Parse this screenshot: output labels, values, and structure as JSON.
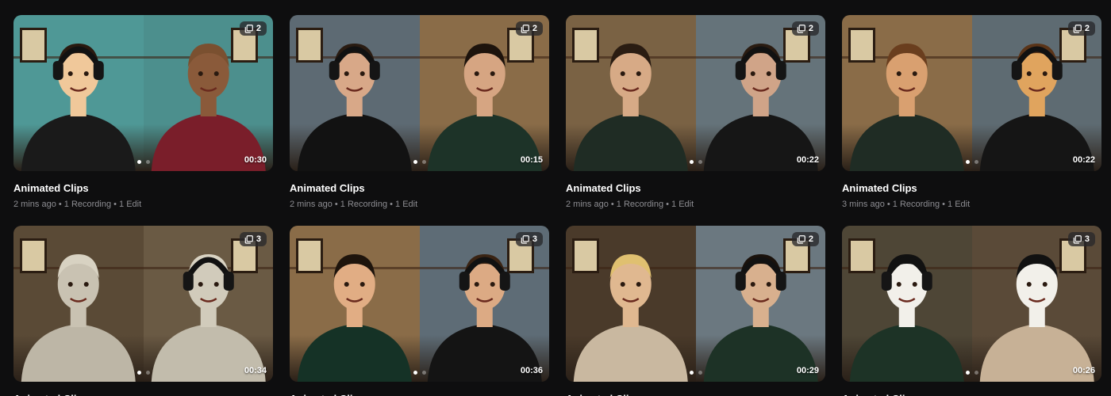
{
  "cards": [
    {
      "title": "Animated Clips",
      "meta": "2 mins ago • 1 Recording • 1 Edit",
      "count": "2",
      "duration": "00:30",
      "left": {
        "bg": "#4f9896",
        "skin": "#f0c89a",
        "shirt": "#1a1a1a",
        "hair": "#2a1a10",
        "headphones": true
      },
      "right": {
        "bg": "#4c8f8d",
        "skin": "#8a5a3a",
        "shirt": "#7a1e2a",
        "hair": "#7a5030",
        "headphones": false
      }
    },
    {
      "title": "Animated Clips",
      "meta": "2 mins ago • 1 Recording • 1 Edit",
      "count": "2",
      "duration": "00:15",
      "left": {
        "bg": "#5d6a73",
        "skin": "#d8a888",
        "shirt": "#121212",
        "hair": "#2a1c12",
        "headphones": true
      },
      "right": {
        "bg": "#8a6c48",
        "skin": "#d6a582",
        "shirt": "#1d3328",
        "hair": "#1d130c",
        "headphones": false
      }
    },
    {
      "title": "Animated Clips",
      "meta": "2 mins ago • 1 Recording • 1 Edit",
      "count": "2",
      "duration": "00:22",
      "left": {
        "bg": "#7a6244",
        "skin": "#d7aa86",
        "shirt": "#1f2c24",
        "hair": "#2a1c12",
        "headphones": false
      },
      "right": {
        "bg": "#65737a",
        "skin": "#d0a488",
        "shirt": "#161616",
        "hair": "#2a1c12",
        "headphones": true
      }
    },
    {
      "title": "Animated Clips",
      "meta": "3 mins ago • 1 Recording • 1 Edit",
      "count": "2",
      "duration": "00:22",
      "left": {
        "bg": "#8a6c48",
        "skin": "#d9a070",
        "shirt": "#1f2c24",
        "hair": "#6a3e1e",
        "headphones": false
      },
      "right": {
        "bg": "#5e6b72",
        "skin": "#e0a45e",
        "shirt": "#151515",
        "hair": "#5a3418",
        "headphones": true
      }
    },
    {
      "title": "Animated Clips",
      "meta": "",
      "count": "3",
      "duration": "00:34",
      "left": {
        "bg": "#5a4a36",
        "skin": "#c9c2b2",
        "shirt": "#bdb6a6",
        "hair": "#d8d2c2",
        "headphones": false
      },
      "right": {
        "bg": "#6a5a44",
        "skin": "#d1cbbb",
        "shirt": "#c2bcac",
        "hair": "#d9d3c3",
        "headphones": true
      }
    },
    {
      "title": "Animated Clips",
      "meta": "",
      "count": "3",
      "duration": "00:36",
      "left": {
        "bg": "#8a6c48",
        "skin": "#e1ad84",
        "shirt": "#153226",
        "hair": "#1e140c",
        "headphones": false
      },
      "right": {
        "bg": "#5e6c76",
        "skin": "#dcaa84",
        "shirt": "#141414",
        "hair": "#3a2414",
        "headphones": true
      }
    },
    {
      "title": "Animated Clips",
      "meta": "",
      "count": "2",
      "duration": "00:29",
      "left": {
        "bg": "#4a3a2a",
        "skin": "#e0b890",
        "shirt": "#c9b8a0",
        "hair": "#e0c070",
        "headphones": false
      },
      "right": {
        "bg": "#6b7880",
        "skin": "#d8b08e",
        "shirt": "#1d3226",
        "hair": "#1a120c",
        "headphones": true
      }
    },
    {
      "title": "Animated Clips",
      "meta": "",
      "count": "3",
      "duration": "00:26",
      "left": {
        "bg": "#4e4636",
        "skin": "#f2f0ea",
        "shirt": "#1d3326",
        "hair": "#111111",
        "headphones": true
      },
      "right": {
        "bg": "#5a4a38",
        "skin": "#f2f0ea",
        "shirt": "#c7b196",
        "hair": "#111111",
        "headphones": false
      }
    }
  ],
  "ui": {
    "accent": "#ffffff",
    "muted": "#8d8d92",
    "background": "#0e0e0f",
    "clips_icon": "layers-icon"
  }
}
